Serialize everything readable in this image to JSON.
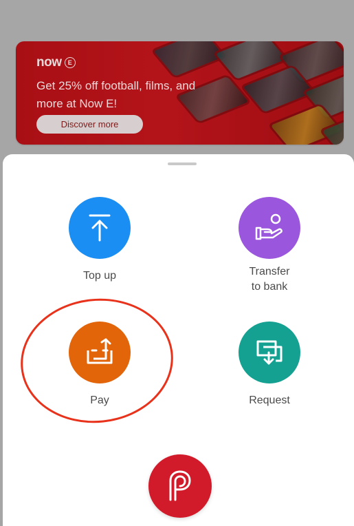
{
  "banner": {
    "brand": "now",
    "brand_badge": "E",
    "text": "Get 25% off football, films, and more at Now E!",
    "button_label": "Discover more"
  },
  "actions": {
    "topup": {
      "label": "Top up",
      "color": "#1a8ef2",
      "icon": "upload-arrow-icon"
    },
    "transfer": {
      "label": "Transfer\nto bank",
      "color": "#9a56dc",
      "icon": "hand-coin-icon"
    },
    "pay": {
      "label": "Pay",
      "color": "#e2650a",
      "icon": "share-out-icon"
    },
    "request": {
      "label": "Request",
      "color": "#14a191",
      "icon": "request-in-icon"
    }
  },
  "fab": {
    "icon": "brand-p-icon",
    "color": "#d21b2a"
  },
  "highlight": {
    "color": "#e8321b",
    "target": "Pay"
  }
}
